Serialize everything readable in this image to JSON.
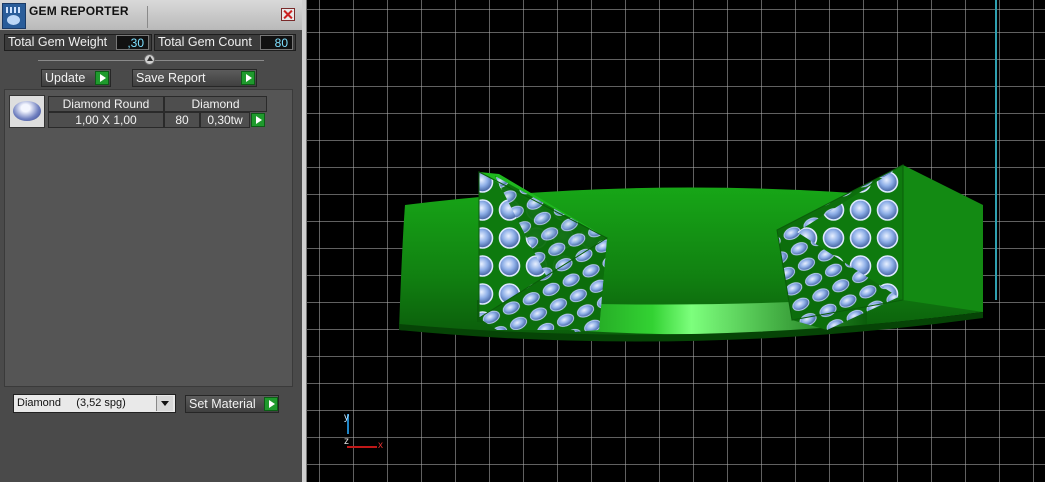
{
  "window": {
    "title": "GEM REPORTER"
  },
  "summary": {
    "total_weight_label": "Total Gem Weight",
    "total_weight_value": ",30",
    "total_count_label": "Total Gem Count",
    "total_count_value": "80"
  },
  "actions": {
    "update_label": "Update",
    "save_report_label": "Save Report"
  },
  "gem_list": [
    {
      "shape": "Diamond Round",
      "material": "Diamond",
      "size": "1,00 X 1,00",
      "count": "80",
      "weight": "0,30tw"
    }
  ],
  "material": {
    "selected": "Diamond     (3,52 spg)",
    "set_material_label": "Set Material"
  },
  "viewport": {
    "axis_labels": {
      "y": "y",
      "z": "z",
      "x": "x"
    },
    "colors": {
      "metal": "#1f9a1f",
      "stone": "#7f9fd6",
      "grid": "#b0b0b0",
      "axis_y": "#2fa0b0",
      "axis_x": "#c01818"
    }
  }
}
